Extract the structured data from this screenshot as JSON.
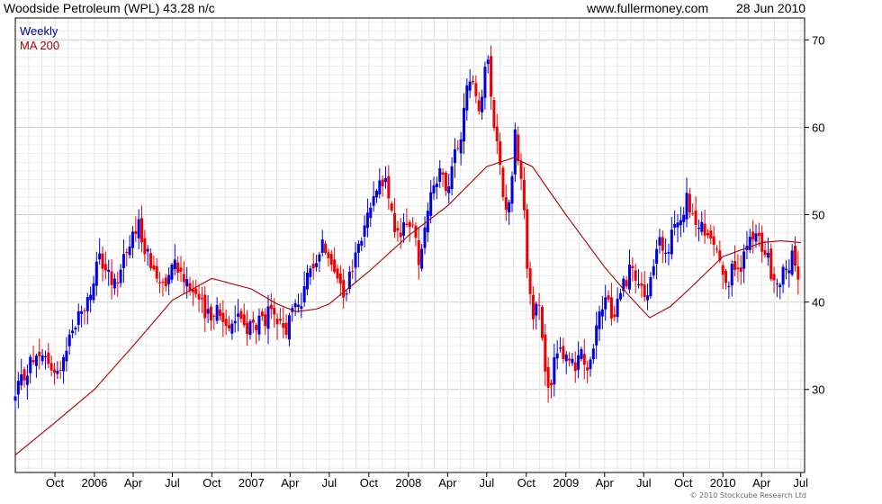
{
  "header": {
    "title": "Woodside Petroleum (WPL) 43.28 n/c",
    "site": "www.fullermoney.com",
    "date": "28 Jun 2010"
  },
  "copyright": "© 2010 Stockcube Research Ltd",
  "colors": {
    "up": "#0000dd",
    "down": "#ee0000",
    "ma": "#aa0000",
    "grid": "#dcdcdc",
    "legend_weekly": "#000099",
    "legend_ma": "#aa0000"
  },
  "chart_data": {
    "type": "candlestick",
    "title": "Woodside Petroleum (WPL) 43.28 n/c",
    "legend": [
      "Weekly",
      "MA 200"
    ],
    "legend_position": "top-left",
    "grid": true,
    "y_axis": {
      "side": "right",
      "ticks": [
        "30",
        "40",
        "50",
        "60",
        "70"
      ],
      "range": [
        20.5,
        72.5
      ]
    },
    "x_axis": {
      "range": [
        "2005-07-01",
        "2010-07-10"
      ],
      "ticks": [
        {
          "label": "Oct",
          "date": "2005-10-01"
        },
        {
          "label": "2006",
          "date": "2006-01-01"
        },
        {
          "label": "Apr",
          "date": "2006-04-01"
        },
        {
          "label": "Jul",
          "date": "2006-07-01"
        },
        {
          "label": "Oct",
          "date": "2006-10-01"
        },
        {
          "label": "2007",
          "date": "2007-01-01"
        },
        {
          "label": "Apr",
          "date": "2007-04-01"
        },
        {
          "label": "Jul",
          "date": "2007-07-01"
        },
        {
          "label": "Oct",
          "date": "2007-10-01"
        },
        {
          "label": "2008",
          "date": "2008-01-01"
        },
        {
          "label": "Apr",
          "date": "2008-04-01"
        },
        {
          "label": "Jul",
          "date": "2008-07-01"
        },
        {
          "label": "Oct",
          "date": "2008-10-01"
        },
        {
          "label": "2009",
          "date": "2009-01-01"
        },
        {
          "label": "Apr",
          "date": "2009-04-01"
        },
        {
          "label": "Jul",
          "date": "2009-07-01"
        },
        {
          "label": "Oct",
          "date": "2009-10-01"
        },
        {
          "label": "2010",
          "date": "2010-01-01"
        },
        {
          "label": "Apr",
          "date": "2010-04-01"
        },
        {
          "label": "Jul",
          "date": "2010-07-01"
        }
      ]
    },
    "close_path_points": [
      [
        "2005-07-01",
        29
      ],
      [
        "2005-08-01",
        33
      ],
      [
        "2005-09-15",
        33.5
      ],
      [
        "2005-10-01",
        31
      ],
      [
        "2005-10-20",
        34
      ],
      [
        "2005-11-15",
        37.5
      ],
      [
        "2005-12-15",
        40
      ],
      [
        "2006-01-15",
        45
      ],
      [
        "2006-02-01",
        43
      ],
      [
        "2006-02-15",
        41.5
      ],
      [
        "2006-03-01",
        44
      ],
      [
        "2006-03-15",
        46
      ],
      [
        "2006-04-15",
        48.5
      ],
      [
        "2006-05-01",
        46
      ],
      [
        "2006-05-20",
        43
      ],
      [
        "2006-06-15",
        42.5
      ],
      [
        "2006-07-01",
        45.5
      ],
      [
        "2006-07-20",
        43.5
      ],
      [
        "2006-08-15",
        42
      ],
      [
        "2006-09-01",
        40
      ],
      [
        "2006-09-20",
        38
      ],
      [
        "2006-10-05",
        39.5
      ],
      [
        "2006-11-01",
        37.5
      ],
      [
        "2006-12-01",
        38.5
      ],
      [
        "2006-12-20",
        37
      ],
      [
        "2007-01-20",
        37.5
      ],
      [
        "2007-02-10",
        38.5
      ],
      [
        "2007-03-01",
        37.5
      ],
      [
        "2007-03-20",
        36.5
      ],
      [
        "2007-04-10",
        39.5
      ],
      [
        "2007-05-01",
        40.5
      ],
      [
        "2007-05-20",
        44
      ],
      [
        "2007-06-10",
        46.5
      ],
      [
        "2007-07-01",
        46
      ],
      [
        "2007-07-15",
        44
      ],
      [
        "2007-08-01",
        40
      ],
      [
        "2007-08-15",
        42
      ],
      [
        "2007-09-01",
        45.5
      ],
      [
        "2007-09-20",
        48
      ],
      [
        "2007-10-10",
        52
      ],
      [
        "2007-10-25",
        55
      ],
      [
        "2007-11-10",
        53
      ],
      [
        "2007-11-25",
        49.5
      ],
      [
        "2007-12-05",
        47
      ],
      [
        "2007-12-25",
        49.5
      ],
      [
        "2008-01-15",
        48
      ],
      [
        "2008-01-25",
        45
      ],
      [
        "2008-02-10",
        48.5
      ],
      [
        "2008-02-25",
        54
      ],
      [
        "2008-03-15",
        54.5
      ],
      [
        "2008-04-01",
        52
      ],
      [
        "2008-04-15",
        56
      ],
      [
        "2008-05-01",
        59
      ],
      [
        "2008-05-15",
        64
      ],
      [
        "2008-06-01",
        66
      ],
      [
        "2008-06-15",
        62
      ],
      [
        "2008-07-01",
        68
      ],
      [
        "2008-07-15",
        62
      ],
      [
        "2008-08-01",
        56
      ],
      [
        "2008-08-15",
        50
      ],
      [
        "2008-08-25",
        52
      ],
      [
        "2008-09-05",
        60
      ],
      [
        "2008-09-15",
        56
      ],
      [
        "2008-09-25",
        51
      ],
      [
        "2008-10-05",
        43
      ],
      [
        "2008-10-15",
        37
      ],
      [
        "2008-10-25",
        41
      ],
      [
        "2008-11-05",
        37
      ],
      [
        "2008-11-20",
        29
      ],
      [
        "2008-12-05",
        33
      ],
      [
        "2008-12-15",
        35.5
      ],
      [
        "2009-01-05",
        33
      ],
      [
        "2009-01-20",
        32.5
      ],
      [
        "2009-02-01",
        34.5
      ],
      [
        "2009-02-15",
        33
      ],
      [
        "2009-03-01",
        32.5
      ],
      [
        "2009-03-15",
        37
      ],
      [
        "2009-04-01",
        40.5
      ],
      [
        "2009-04-20",
        38.5
      ],
      [
        "2009-05-10",
        41.5
      ],
      [
        "2009-06-01",
        44
      ],
      [
        "2009-06-20",
        41
      ],
      [
        "2009-07-10",
        40.5
      ],
      [
        "2009-07-25",
        44.5
      ],
      [
        "2009-08-10",
        47
      ],
      [
        "2009-08-25",
        45
      ],
      [
        "2009-09-10",
        48.5
      ],
      [
        "2009-09-25",
        50
      ],
      [
        "2009-10-10",
        51.5
      ],
      [
        "2009-10-25",
        49
      ],
      [
        "2009-11-10",
        48.5
      ],
      [
        "2009-11-25",
        47.5
      ],
      [
        "2009-12-10",
        47
      ],
      [
        "2009-12-25",
        45.5
      ],
      [
        "2010-01-10",
        42.5
      ],
      [
        "2010-01-25",
        43.5
      ],
      [
        "2010-02-10",
        44
      ],
      [
        "2010-03-01",
        46.5
      ],
      [
        "2010-03-20",
        47.5
      ],
      [
        "2010-04-05",
        46
      ],
      [
        "2010-04-20",
        44
      ],
      [
        "2010-05-05",
        42
      ],
      [
        "2010-05-20",
        43
      ],
      [
        "2010-06-10",
        45
      ],
      [
        "2010-06-28",
        43.28
      ]
    ],
    "ma_200_points": [
      [
        "2005-07-01",
        22.5
      ],
      [
        "2005-10-01",
        26.2
      ],
      [
        "2006-01-01",
        30
      ],
      [
        "2006-04-01",
        35
      ],
      [
        "2006-07-01",
        40.2
      ],
      [
        "2006-10-01",
        42.7
      ],
      [
        "2007-01-01",
        41.5
      ],
      [
        "2007-03-01",
        39.8
      ],
      [
        "2007-04-15",
        38.9
      ],
      [
        "2007-06-01",
        39.2
      ],
      [
        "2007-07-01",
        39.8
      ],
      [
        "2007-10-01",
        43.5
      ],
      [
        "2008-01-01",
        47.6
      ],
      [
        "2008-04-01",
        51
      ],
      [
        "2008-07-01",
        55.5
      ],
      [
        "2008-09-01",
        56.5
      ],
      [
        "2008-10-15",
        55.5
      ],
      [
        "2009-01-01",
        50
      ],
      [
        "2009-04-01",
        44
      ],
      [
        "2009-06-01",
        40.5
      ],
      [
        "2009-07-15",
        38.2
      ],
      [
        "2009-09-01",
        39.5
      ],
      [
        "2009-10-15",
        41.5
      ],
      [
        "2010-01-01",
        45.2
      ],
      [
        "2010-04-01",
        46.8
      ],
      [
        "2010-05-15",
        47
      ],
      [
        "2010-07-01",
        46.8
      ]
    ]
  }
}
